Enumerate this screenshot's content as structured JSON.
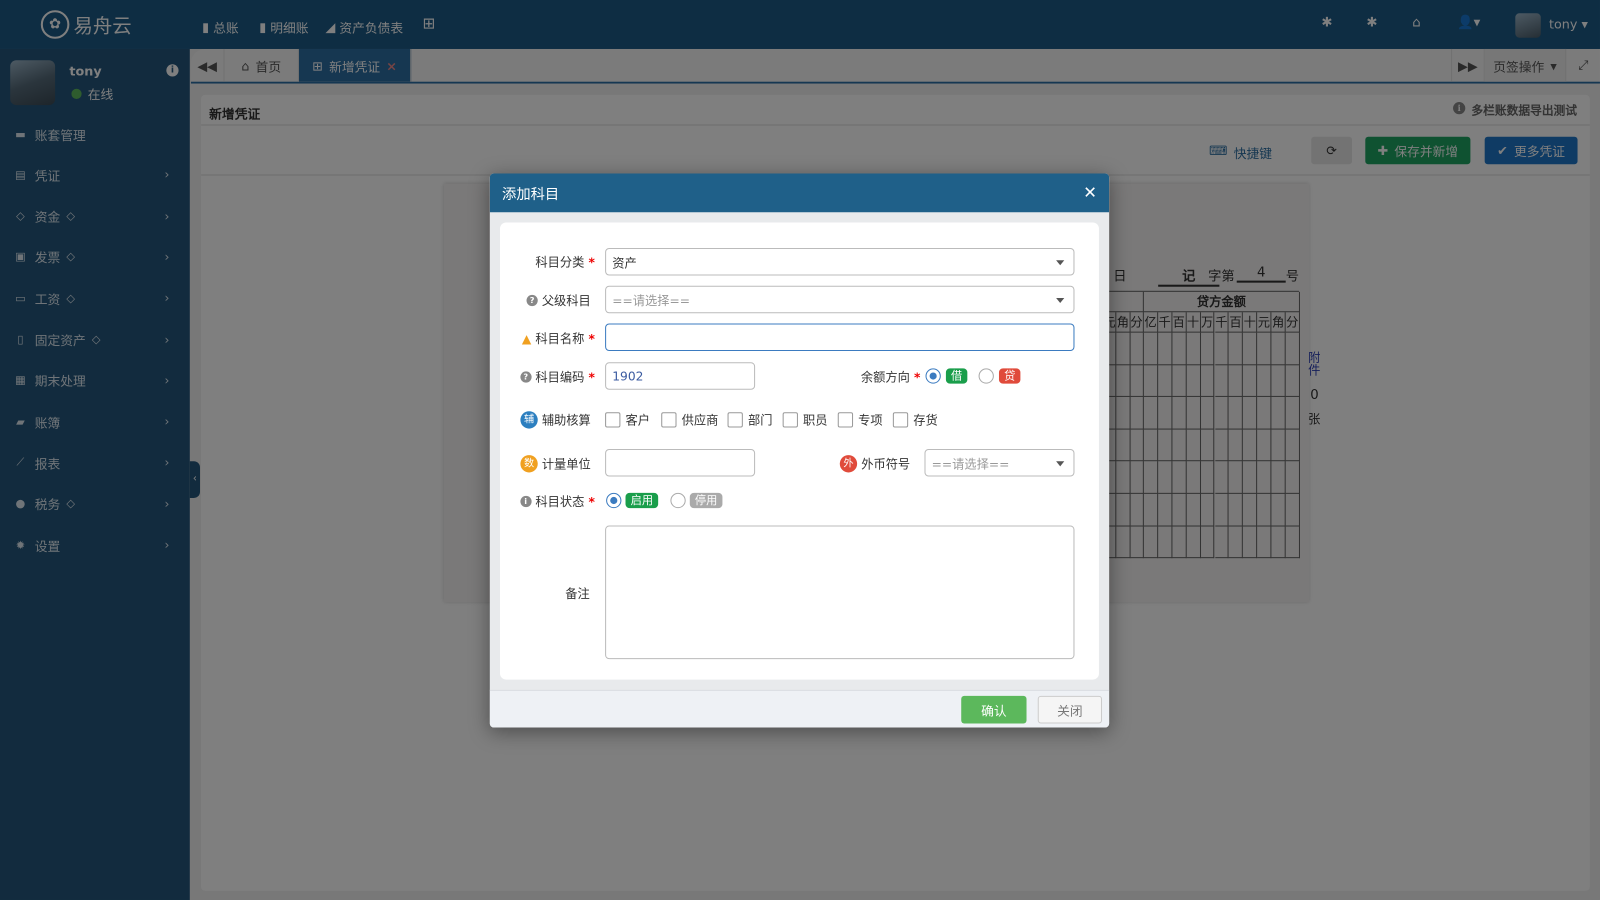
{
  "app": {
    "logo_text": "易舟云",
    "user": "tony",
    "status": "在线"
  },
  "topnav": [
    {
      "label": "总账",
      "icon": "bookmark-icon"
    },
    {
      "label": "明细账",
      "icon": "bookmark-icon"
    },
    {
      "label": "资产负债表",
      "icon": "area-chart-icon"
    }
  ],
  "sidebar": {
    "items": [
      {
        "label": "账套管理",
        "icon": "archive-icon",
        "premium": false,
        "submenu": false
      },
      {
        "label": "凭证",
        "icon": "newspaper-icon",
        "premium": false,
        "submenu": true
      },
      {
        "label": "资金",
        "icon": "link-icon",
        "premium": true,
        "submenu": true
      },
      {
        "label": "发票",
        "icon": "object-group-icon",
        "premium": true,
        "submenu": true
      },
      {
        "label": "工资",
        "icon": "credit-card-icon",
        "premium": true,
        "submenu": true
      },
      {
        "label": "固定资产",
        "icon": "building-icon",
        "premium": true,
        "submenu": true
      },
      {
        "label": "期末处理",
        "icon": "calendar-icon",
        "premium": false,
        "submenu": true
      },
      {
        "label": "账簿",
        "icon": "book-icon",
        "premium": false,
        "submenu": true
      },
      {
        "label": "报表",
        "icon": "line-chart-icon",
        "premium": false,
        "submenu": true
      },
      {
        "label": "税务",
        "icon": "compass-icon",
        "premium": true,
        "submenu": true
      },
      {
        "label": "设置",
        "icon": "gear-icon",
        "premium": false,
        "submenu": true
      }
    ]
  },
  "tabs": {
    "items": [
      {
        "label": "首页",
        "active": false
      },
      {
        "label": "新增凭证",
        "active": true
      }
    ],
    "actions_label": "页签操作"
  },
  "panel": {
    "title": "新增凭证",
    "notice": "多栏账数据导出测试",
    "shortcut_label": "快捷键",
    "save_new_label": "保存并新增",
    "more_label": "更多凭证"
  },
  "voucher": {
    "day_label": "日",
    "type": "记",
    "word_label": "字第",
    "number": "4",
    "number_suffix": "号",
    "credit_header": "贷方金额",
    "digit_units": [
      "亿",
      "千",
      "百",
      "十",
      "万",
      "千",
      "百",
      "十",
      "元",
      "角",
      "分"
    ],
    "partial_units": [
      "元",
      "角",
      "分"
    ],
    "attachment_label_1": "附",
    "attachment_label_2": "件",
    "attachment_count": "0",
    "attachment_unit": "张"
  },
  "modal": {
    "title": "添加科目",
    "category": {
      "label": "科目分类",
      "value": "资产"
    },
    "parent": {
      "label": "父级科目",
      "placeholder": "==请选择=="
    },
    "name": {
      "label": "科目名称",
      "value": ""
    },
    "code": {
      "label": "科目编码",
      "value": "1902"
    },
    "direction": {
      "label": "余额方向",
      "options": [
        "借",
        "贷"
      ],
      "selected": "借"
    },
    "auxiliary": {
      "label": "辅助核算",
      "badge": "辅",
      "options": [
        "客户",
        "供应商",
        "部门",
        "职员",
        "专项",
        "存货"
      ]
    },
    "unit": {
      "label": "计量单位",
      "badge": "数",
      "value": ""
    },
    "currency": {
      "label": "外币符号",
      "badge": "外",
      "placeholder": "==请选择=="
    },
    "status": {
      "label": "科目状态",
      "options": [
        "启用",
        "停用"
      ],
      "selected": "启用"
    },
    "remark": {
      "label": "备注",
      "value": ""
    },
    "confirm_label": "确认",
    "close_label": "关闭"
  },
  "colors": {
    "topbar": "#1d5b87",
    "sidebar": "#24577c",
    "modal_header": "#1f6089",
    "green": "#5cb85c",
    "blue": "#2c6fa3",
    "debit": "#1a9e4b",
    "credit": "#e04b3b"
  }
}
